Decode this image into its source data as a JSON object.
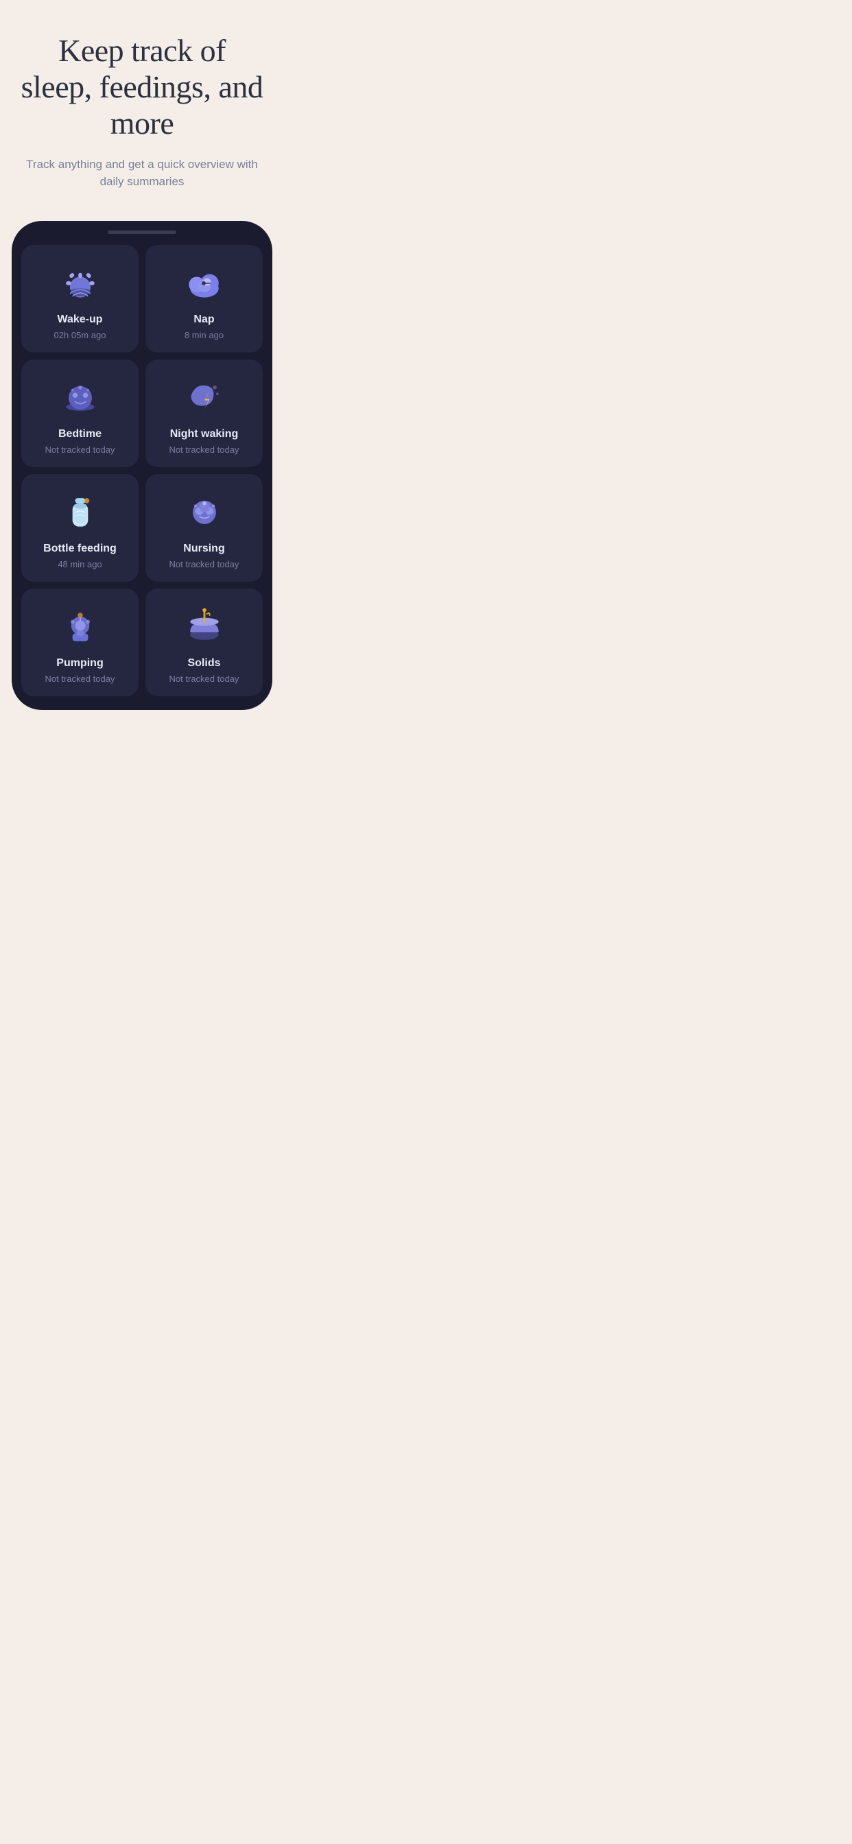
{
  "header": {
    "title": "Keep track of sleep, feedings, and more",
    "subtitle": "Track anything and get a quick overview with daily summaries"
  },
  "cards": [
    {
      "id": "wake-up",
      "title": "Wake-up",
      "subtitle": "02h 05m ago",
      "icon": "sunrise"
    },
    {
      "id": "nap",
      "title": "Nap",
      "subtitle": "8 min ago",
      "icon": "cloud-sleep"
    },
    {
      "id": "bedtime",
      "title": "Bedtime",
      "subtitle": "Not tracked today",
      "icon": "bedtime"
    },
    {
      "id": "night-waking",
      "title": "Night waking",
      "subtitle": "Not tracked today",
      "icon": "night-lightning"
    },
    {
      "id": "bottle-feeding",
      "title": "Bottle feeding",
      "subtitle": "48 min ago",
      "icon": "bottle"
    },
    {
      "id": "nursing",
      "title": "Nursing",
      "subtitle": "Not tracked today",
      "icon": "nursing"
    },
    {
      "id": "pumping",
      "title": "Pumping",
      "subtitle": "Not tracked today",
      "icon": "pumping"
    },
    {
      "id": "solids",
      "title": "Solids",
      "subtitle": "Not tracked today",
      "icon": "solids"
    }
  ]
}
